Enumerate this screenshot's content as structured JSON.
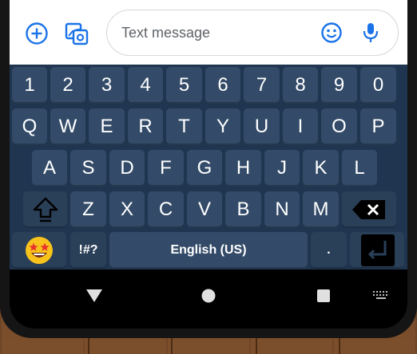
{
  "message_bar": {
    "add_icon": "add-circle-icon",
    "gallery_icon": "photo-gallery-icon",
    "input_placeholder": "Text message",
    "emoji_icon": "emoji-smile-icon",
    "mic_icon": "microphone-icon",
    "accent_color": "#1a73e8"
  },
  "keyboard": {
    "number_row": [
      "1",
      "2",
      "3",
      "4",
      "5",
      "6",
      "7",
      "8",
      "9",
      "0"
    ],
    "row1": [
      "Q",
      "W",
      "E",
      "R",
      "T",
      "Y",
      "U",
      "I",
      "O",
      "P"
    ],
    "row2": [
      "A",
      "S",
      "D",
      "F",
      "G",
      "H",
      "J",
      "K",
      "L"
    ],
    "row3": [
      "Z",
      "X",
      "C",
      "V",
      "B",
      "N",
      "M"
    ],
    "shift_icon": "shift-arrow-icon",
    "backspace_icon": "backspace-icon",
    "emoji_key_icon": "star-eyes-emoji-icon",
    "symbols_label": "!#?",
    "space_label": "English (US)",
    "period_label": ".",
    "enter_icon": "enter-return-icon",
    "key_color": "#334b68",
    "background_color": "#1f3550"
  },
  "nav_bar": {
    "back_icon": "back-triangle-icon",
    "home_icon": "home-circle-icon",
    "recents_icon": "recents-square-icon",
    "keyboard_icon": "keyboard-hide-icon"
  }
}
